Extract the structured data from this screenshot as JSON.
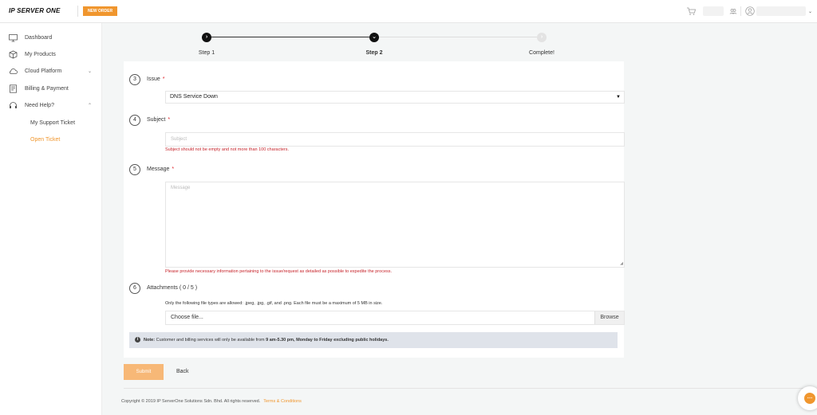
{
  "header": {
    "logo": "IP SERVER ONE",
    "new_order": "NEW ORDER"
  },
  "sidebar": {
    "items": [
      {
        "label": "Dashboard",
        "icon": "monitor-icon"
      },
      {
        "label": "My Products",
        "icon": "box-icon"
      },
      {
        "label": "Cloud Platform",
        "icon": "cloud-icon"
      },
      {
        "label": "Billing & Payment",
        "icon": "billing-icon"
      },
      {
        "label": "Need Help?",
        "icon": "headset-icon"
      }
    ],
    "sub_items": [
      {
        "label": "My Support Ticket"
      },
      {
        "label": "Open Ticket"
      }
    ]
  },
  "stepper": {
    "steps": [
      {
        "label": "Step 1",
        "mark": "›"
      },
      {
        "label": "Step 2",
        "mark": "⌄"
      },
      {
        "label": "Complete!",
        "mark": "›"
      }
    ]
  },
  "form": {
    "issue": {
      "number": "3",
      "label": "Issue",
      "required": "*",
      "value": "DNS Service Down"
    },
    "subject": {
      "number": "4",
      "label": "Subject",
      "required": "*",
      "placeholder": "Subject",
      "error": "Subject should not be empty and not more than 100 characters."
    },
    "message": {
      "number": "5",
      "label": "Message",
      "required": "*",
      "placeholder": "Message",
      "error": "Please provide necessary information pertaining to the issue/request as detailed as possible to expedite the process."
    },
    "attachments": {
      "number": "6",
      "label": "Attachments ( 0 / 5 )",
      "hint": "Only the following file types are allowed: .jpeg, .jpg, .gif, and .png. Each file must be a maximum of 5 MB in size.",
      "file_placeholder": "Choose file...",
      "browse": "Browse"
    },
    "note": {
      "bold_label": "Note:",
      "text": " Customer and billing services will only be available from ",
      "bold_hours": "9 am-5.30 pm, Monday to Friday excluding public holidays."
    }
  },
  "actions": {
    "submit": "Submit",
    "back": "Back"
  },
  "footer": {
    "copyright": "Copyright © 2019 IP ServerOne Solutions Sdn. Bhd. All rights reserved.",
    "terms": "Terms & Conditions"
  },
  "colors": {
    "accent": "#f0962e",
    "error": "#c7242b",
    "required": "#e0252c"
  }
}
